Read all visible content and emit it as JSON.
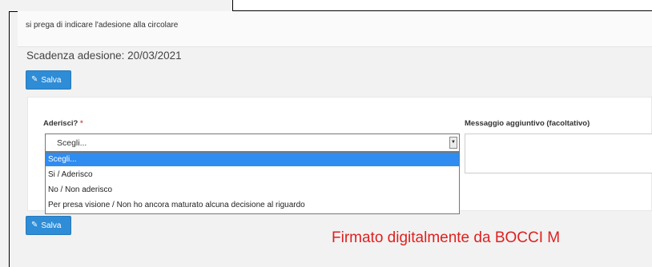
{
  "message": {
    "text": "si prega di indicare l'adesione alla circolare"
  },
  "deadline": {
    "text": "Scadenza adesione: 20/03/2021"
  },
  "save_button": {
    "label": "Salva",
    "icon": "edit-icon"
  },
  "form": {
    "adhere_label": "Aderisci?",
    "required_marker": "*",
    "message_label": "Messaggio aggiuntivo (facoltativo)",
    "select": {
      "selected": "Scegli...",
      "options": [
        "Scegli...",
        "Si / Aderisco",
        "No / Non aderisco",
        "Per presa visione / Non ho ancora maturato alcuna decisione al riguardo"
      ],
      "highlighted_index": 0
    }
  },
  "signature": {
    "text": "Firmato digitalmente da BOCCI M"
  },
  "colors": {
    "primary_button": "#2f8cd6",
    "highlight": "#2f8cf0",
    "signature": "#e01f1f",
    "required": "#d9534f"
  }
}
